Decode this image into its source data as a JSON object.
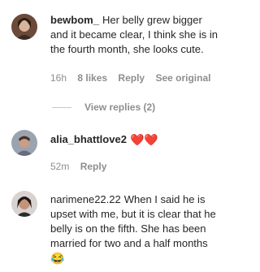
{
  "comments": [
    {
      "username": "bewbom_",
      "lines": [
        "Her belly grew bigger",
        "and it became clear, I think she is in",
        "the fourth month, she looks cute."
      ],
      "time": "16h",
      "likes": "8 likes",
      "reply": "Reply",
      "see_original": "See original",
      "view_replies": "View replies (2)"
    },
    {
      "username": "alia_bhattlove2",
      "emoji": "❤️❤️",
      "time": "52m",
      "reply": "Reply"
    },
    {
      "username": "narimene22.22",
      "lines": [
        "When I said he is",
        "upset with me, but it is clear that he",
        "belly is on the fifth. She has been",
        "married for two and a half months"
      ],
      "emoji_line": "😂"
    }
  ],
  "colors": {
    "text": "#262626",
    "meta": "#8e8e8e",
    "heart": "#ed1c2e"
  }
}
